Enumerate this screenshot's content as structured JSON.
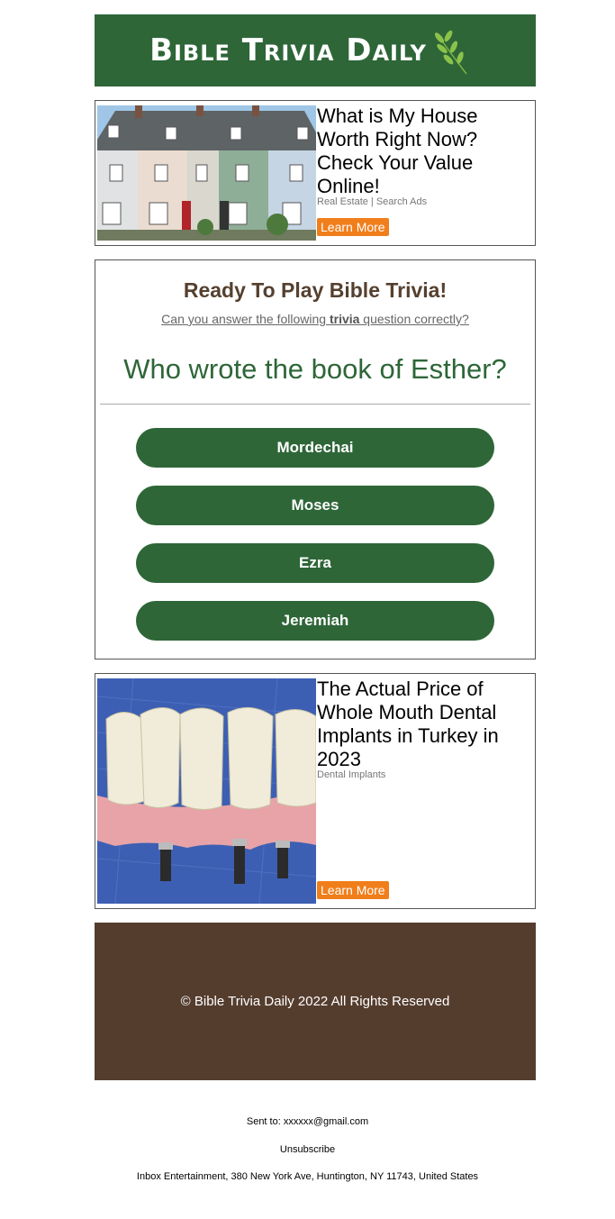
{
  "header": {
    "logo_text": "Bible Trivia Daily",
    "brand_color": "#2e6638"
  },
  "ads": [
    {
      "title": "What is My House Worth Right Now? Check Your Value Online!",
      "source": "Real Estate | Search Ads",
      "cta": "Learn More",
      "image_icon": "row-houses-photo"
    },
    {
      "title": "The Actual Price of Whole Mouth Dental Implants in Turkey in 2023",
      "source": "Dental Implants",
      "cta": "Learn More",
      "image_icon": "dental-implant-photo"
    }
  ],
  "trivia": {
    "heading": "Ready To Play Bible Trivia!",
    "sub_before": "Can you answer the following ",
    "sub_bold": "trivia",
    "sub_after": " question correctly?",
    "question": "Who wrote the book of Esther?",
    "answers": [
      "Mordechai",
      "Moses",
      "Ezra",
      "Jeremiah"
    ]
  },
  "footer": {
    "copyright": "© Bible Trivia Daily 2022 All Rights Reserved",
    "bg_color": "#553d2e"
  },
  "meta": {
    "sent_to": "Sent to: xxxxxx@gmail.com",
    "unsubscribe": "Unsubscribe",
    "address": "Inbox Entertainment, 380 New York Ave, Huntington, NY 11743, United States"
  },
  "colors": {
    "accent": "#f07e1b"
  }
}
